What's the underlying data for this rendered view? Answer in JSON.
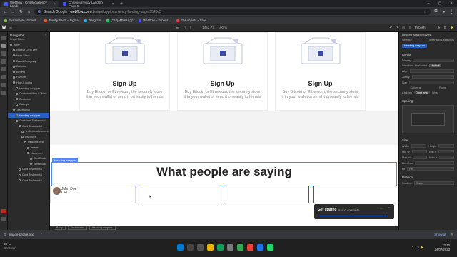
{
  "browser": {
    "tabs": [
      {
        "title": "Webflow - Cryptocurrency Landi"
      },
      {
        "title": "Cryptocurrency Landing Page 5"
      }
    ],
    "address": {
      "search_label": "Search Google",
      "domain": "webflow.com",
      "path": "/design/cryptocurrency-landing-page-5546c3"
    },
    "bookmarks": [
      "Sustainable Harvest...",
      "Twinfly SaaS – Figma",
      "Telegram",
      "(163) WhatsApp",
      "Webflow – Fitness...",
      "BIM objects – Free..."
    ]
  },
  "webflow": {
    "toolbar": {
      "dims": "1452 PX",
      "zoom": "100 %",
      "publish": "Publish"
    },
    "navigator": {
      "title": "Navigator",
      "page": "Page: Home",
      "items": [
        {
          "label": "Body",
          "indent": 0
        },
        {
          "label": "Navbar Logo Left",
          "indent": 1
        },
        {
          "label": "Hero Stack",
          "indent": 1
        },
        {
          "label": "Brand Company",
          "indent": 1
        },
        {
          "label": "Buttons",
          "indent": 1
        },
        {
          "label": "Benefit",
          "indent": 1
        },
        {
          "label": "Feature",
          "indent": 1
        },
        {
          "label": "How-It-works",
          "indent": 1
        },
        {
          "label": "Heading-wrapper",
          "indent": 2
        },
        {
          "label": "Container How-It-Work",
          "indent": 2
        },
        {
          "label": "Container",
          "indent": 2
        },
        {
          "label": "Ratings",
          "indent": 2
        },
        {
          "label": "Testimonial",
          "indent": 1
        },
        {
          "label": "Heading-wrapper",
          "indent": 2,
          "selected": true
        },
        {
          "label": "Container Testimonial",
          "indent": 2
        },
        {
          "label": "Card Testimonial",
          "indent": 3
        },
        {
          "label": "Testimonial content",
          "indent": 4
        },
        {
          "label": "Div Block",
          "indent": 4
        },
        {
          "label": "Heading-Testi",
          "indent": 5
        },
        {
          "label": "Image",
          "indent": 6
        },
        {
          "label": "Name-job",
          "indent": 6
        },
        {
          "label": "Text Block",
          "indent": 7
        },
        {
          "label": "Text Block",
          "indent": 7
        },
        {
          "label": "Card Testimonial",
          "indent": 3
        },
        {
          "label": "Card Testimonial",
          "indent": 3
        },
        {
          "label": "Card Testimonial",
          "indent": 3
        }
      ]
    },
    "canvas": {
      "cards": [
        {
          "title": "Sign Up",
          "text": "Buy Bitcoin or Ethereum, the securely store it in your wallet or send it on easily to friends"
        },
        {
          "title": "Sign Up",
          "text": "Buy Bitcoin or Ethereum, the securely store it in your wallet or send it on easily to friends"
        },
        {
          "title": "Sign Up",
          "text": "Buy Bitcoin or Ethereum, the securely store it in your wallet or send it on easily to friends"
        }
      ],
      "selected_label": "Heading wrapper",
      "heading": "What people are saying",
      "person": {
        "name": "John Doe",
        "role": "CEO"
      },
      "getstarted": {
        "title": "Get started",
        "progress_text": "6 of 6 complete",
        "progress": 1.0
      }
    },
    "breadcrumbs": [
      "Body",
      "Testimonial",
      "Heading wrapper"
    ],
    "style_panel": {
      "element": "Heading wrapper Styles",
      "selector_label": "Selector",
      "inheriting": "Inheriting 1 selectors",
      "chip": "Heading wrapper",
      "layout": "Layout",
      "display": "Display",
      "direction": "Direction",
      "horizontal": "Horizontal",
      "vertical": "Vertical",
      "align": "Align",
      "justify": "Justify",
      "gap": "Gap",
      "columns": "Columns",
      "rows": "Rows",
      "children": "Children",
      "dont_wrap": "Don't wrap",
      "wrap": "Wrap",
      "spacing": "Spacing",
      "size": "Size",
      "width": "Width",
      "height": "Height",
      "min_w": "Min W",
      "min_h": "Min H",
      "max_w": "Max W",
      "max_h": "Max H",
      "auto": "Auto",
      "none": "None",
      "overflow": "Overflow",
      "fit": "Fit",
      "fill": "Fill",
      "position": "Position",
      "position_val": "Static"
    }
  },
  "download": {
    "file": "image-profile.png",
    "show_all": "Show all"
  },
  "taskbar": {
    "temp": "34°C",
    "weather": "Berawan",
    "time": "22:13",
    "date": "24/07/2023"
  }
}
